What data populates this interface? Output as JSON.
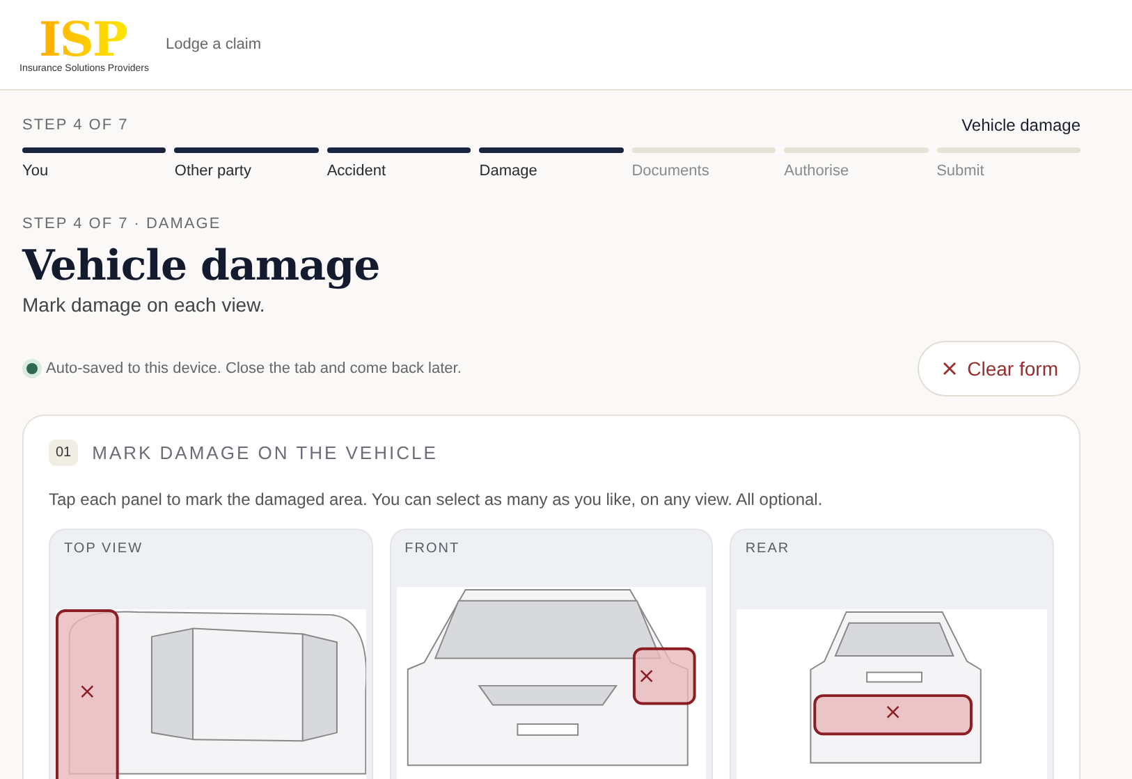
{
  "header": {
    "logo": "ISP",
    "logo_caption": "Insurance Solutions Providers",
    "link": "Lodge a claim"
  },
  "progress": {
    "step_label": "STEP 4 OF 7",
    "current_title": "Vehicle damage",
    "steps": [
      {
        "label": "You",
        "done": true
      },
      {
        "label": "Other party",
        "done": true
      },
      {
        "label": "Accident",
        "done": true
      },
      {
        "label": "Damage",
        "done": true
      },
      {
        "label": "Documents",
        "done": false
      },
      {
        "label": "Authorise",
        "done": false
      },
      {
        "label": "Submit",
        "done": false
      }
    ]
  },
  "eyebrow": "STEP 4 OF 7 · DAMAGE",
  "title": "Vehicle damage",
  "subtitle": "Mark damage on each view.",
  "autosave": "Auto-saved to this device. Close the tab and come back later.",
  "clear_button": "Clear form",
  "section": {
    "number": "01",
    "heading": "MARK DAMAGE ON THE VEHICLE",
    "hint": "Tap each panel to mark the damaged area. You can select as many as you like, on any view. All optional.",
    "views": [
      {
        "title": "TOP VIEW",
        "kind": "top",
        "zones": [
          {
            "selected": true
          }
        ]
      },
      {
        "title": "FRONT",
        "kind": "front",
        "zones": [
          {
            "selected": true
          }
        ]
      },
      {
        "title": "REAR",
        "kind": "rear",
        "zones": [
          {
            "selected": true
          }
        ]
      }
    ]
  }
}
